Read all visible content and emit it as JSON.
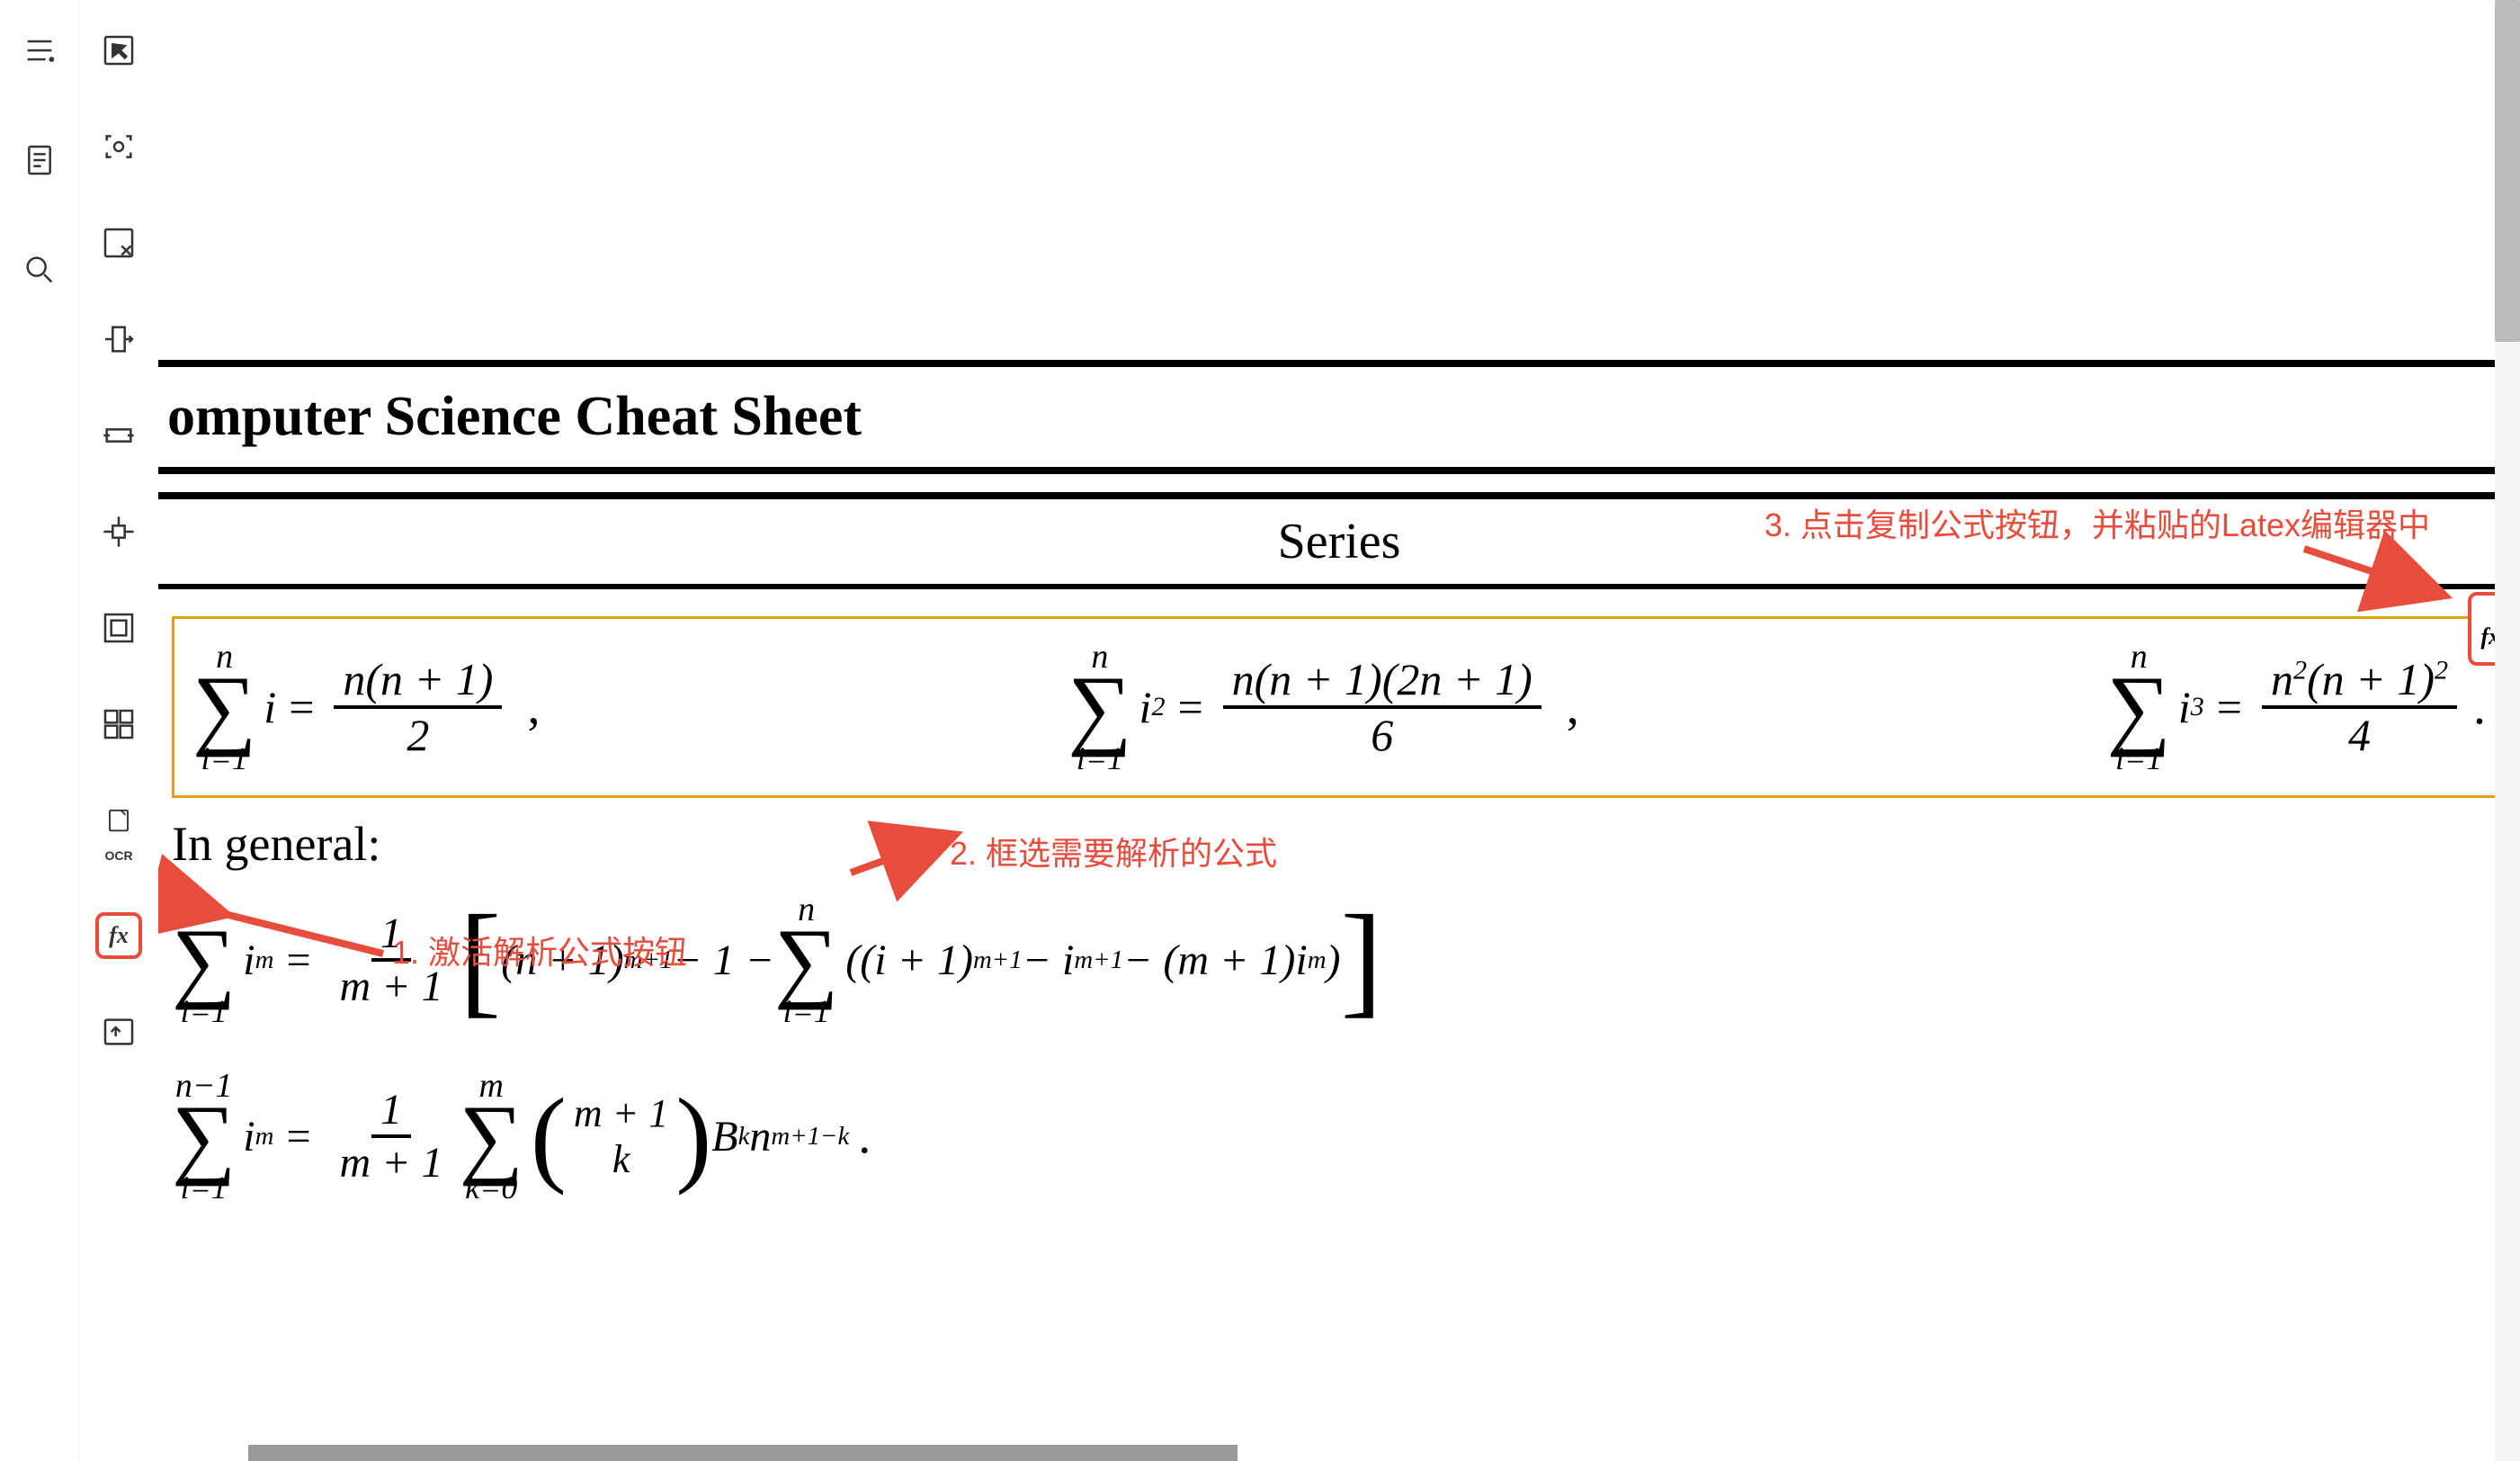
{
  "sidebar": {
    "items": [
      "menu",
      "document",
      "search"
    ]
  },
  "toolbar": {
    "items": [
      "cursor",
      "capture",
      "close-region",
      "crop-width",
      "crop-horizontal",
      "grid-center",
      "bounds",
      "grid-view",
      "ocr",
      "formula",
      "export"
    ]
  },
  "document": {
    "title": "omputer Science Cheat Sheet",
    "section": "Series",
    "in_general": "In general:"
  },
  "formulas": {
    "f1_sum_top": "n",
    "f1_sum_bot": "i=1",
    "f1_var": "i",
    "f1_eq": "=",
    "f1_frac_top": "n(n + 1)",
    "f1_frac_bot": "2",
    "f2_sum_top": "n",
    "f2_sum_bot": "i=1",
    "f2_var": "i",
    "f2_pow": "2",
    "f2_eq": "=",
    "f2_frac_top": "n(n + 1)(2n + 1)",
    "f2_frac_bot": "6",
    "f3_sum_top": "n",
    "f3_sum_bot": "i=1",
    "f3_var": "i",
    "f3_pow": "3",
    "f3_eq": "=",
    "f3_frac_top_a": "n",
    "f3_frac_top_a_pow": "2",
    "f3_frac_top_b": "(n + 1)",
    "f3_frac_top_b_pow": "2",
    "f3_frac_bot": "4",
    "comma": ",",
    "dot": ".",
    "g1_sum_top": "n",
    "g1_sum_bot": "i=1",
    "g1_var": "i",
    "g1_pow": "m",
    "g1_eq": "=",
    "g1_frac_top": "1",
    "g1_frac_bot": "m + 1",
    "g1_body_a": "(n + 1)",
    "g1_body_a_pow": "m+1",
    "g1_minus1": " − 1 − ",
    "g1_sum2_top": "n",
    "g1_sum2_bot": "i=1",
    "g1_body_b": "((i + 1)",
    "g1_body_b_pow": "m+1",
    "g1_body_c": " − i",
    "g1_body_c_pow": "m+1",
    "g1_body_d": " − (m + 1)i",
    "g1_body_d_pow": "m",
    "g1_body_e": ")",
    "g2_sum_top": "n−1",
    "g2_sum_bot": "i=1",
    "g2_var": "i",
    "g2_pow": "m",
    "g2_eq": "=",
    "g2_frac_top": "1",
    "g2_frac_bot": "m + 1",
    "g2_sum2_top": "m",
    "g2_sum2_bot": "k=0",
    "g2_binom_top": "m + 1",
    "g2_binom_bot": "k",
    "g2_bk": "B",
    "g2_bk_sub": "k",
    "g2_n": "n",
    "g2_n_pow": "m+1−k"
  },
  "annotations": {
    "a1": "1. 激活解析公式按钮",
    "a2": "2. 框选需要解析的公式",
    "a3": "3. 点击复制公式按钮，并粘贴的Latex编辑器中"
  },
  "badges": {
    "fx": "fx"
  }
}
